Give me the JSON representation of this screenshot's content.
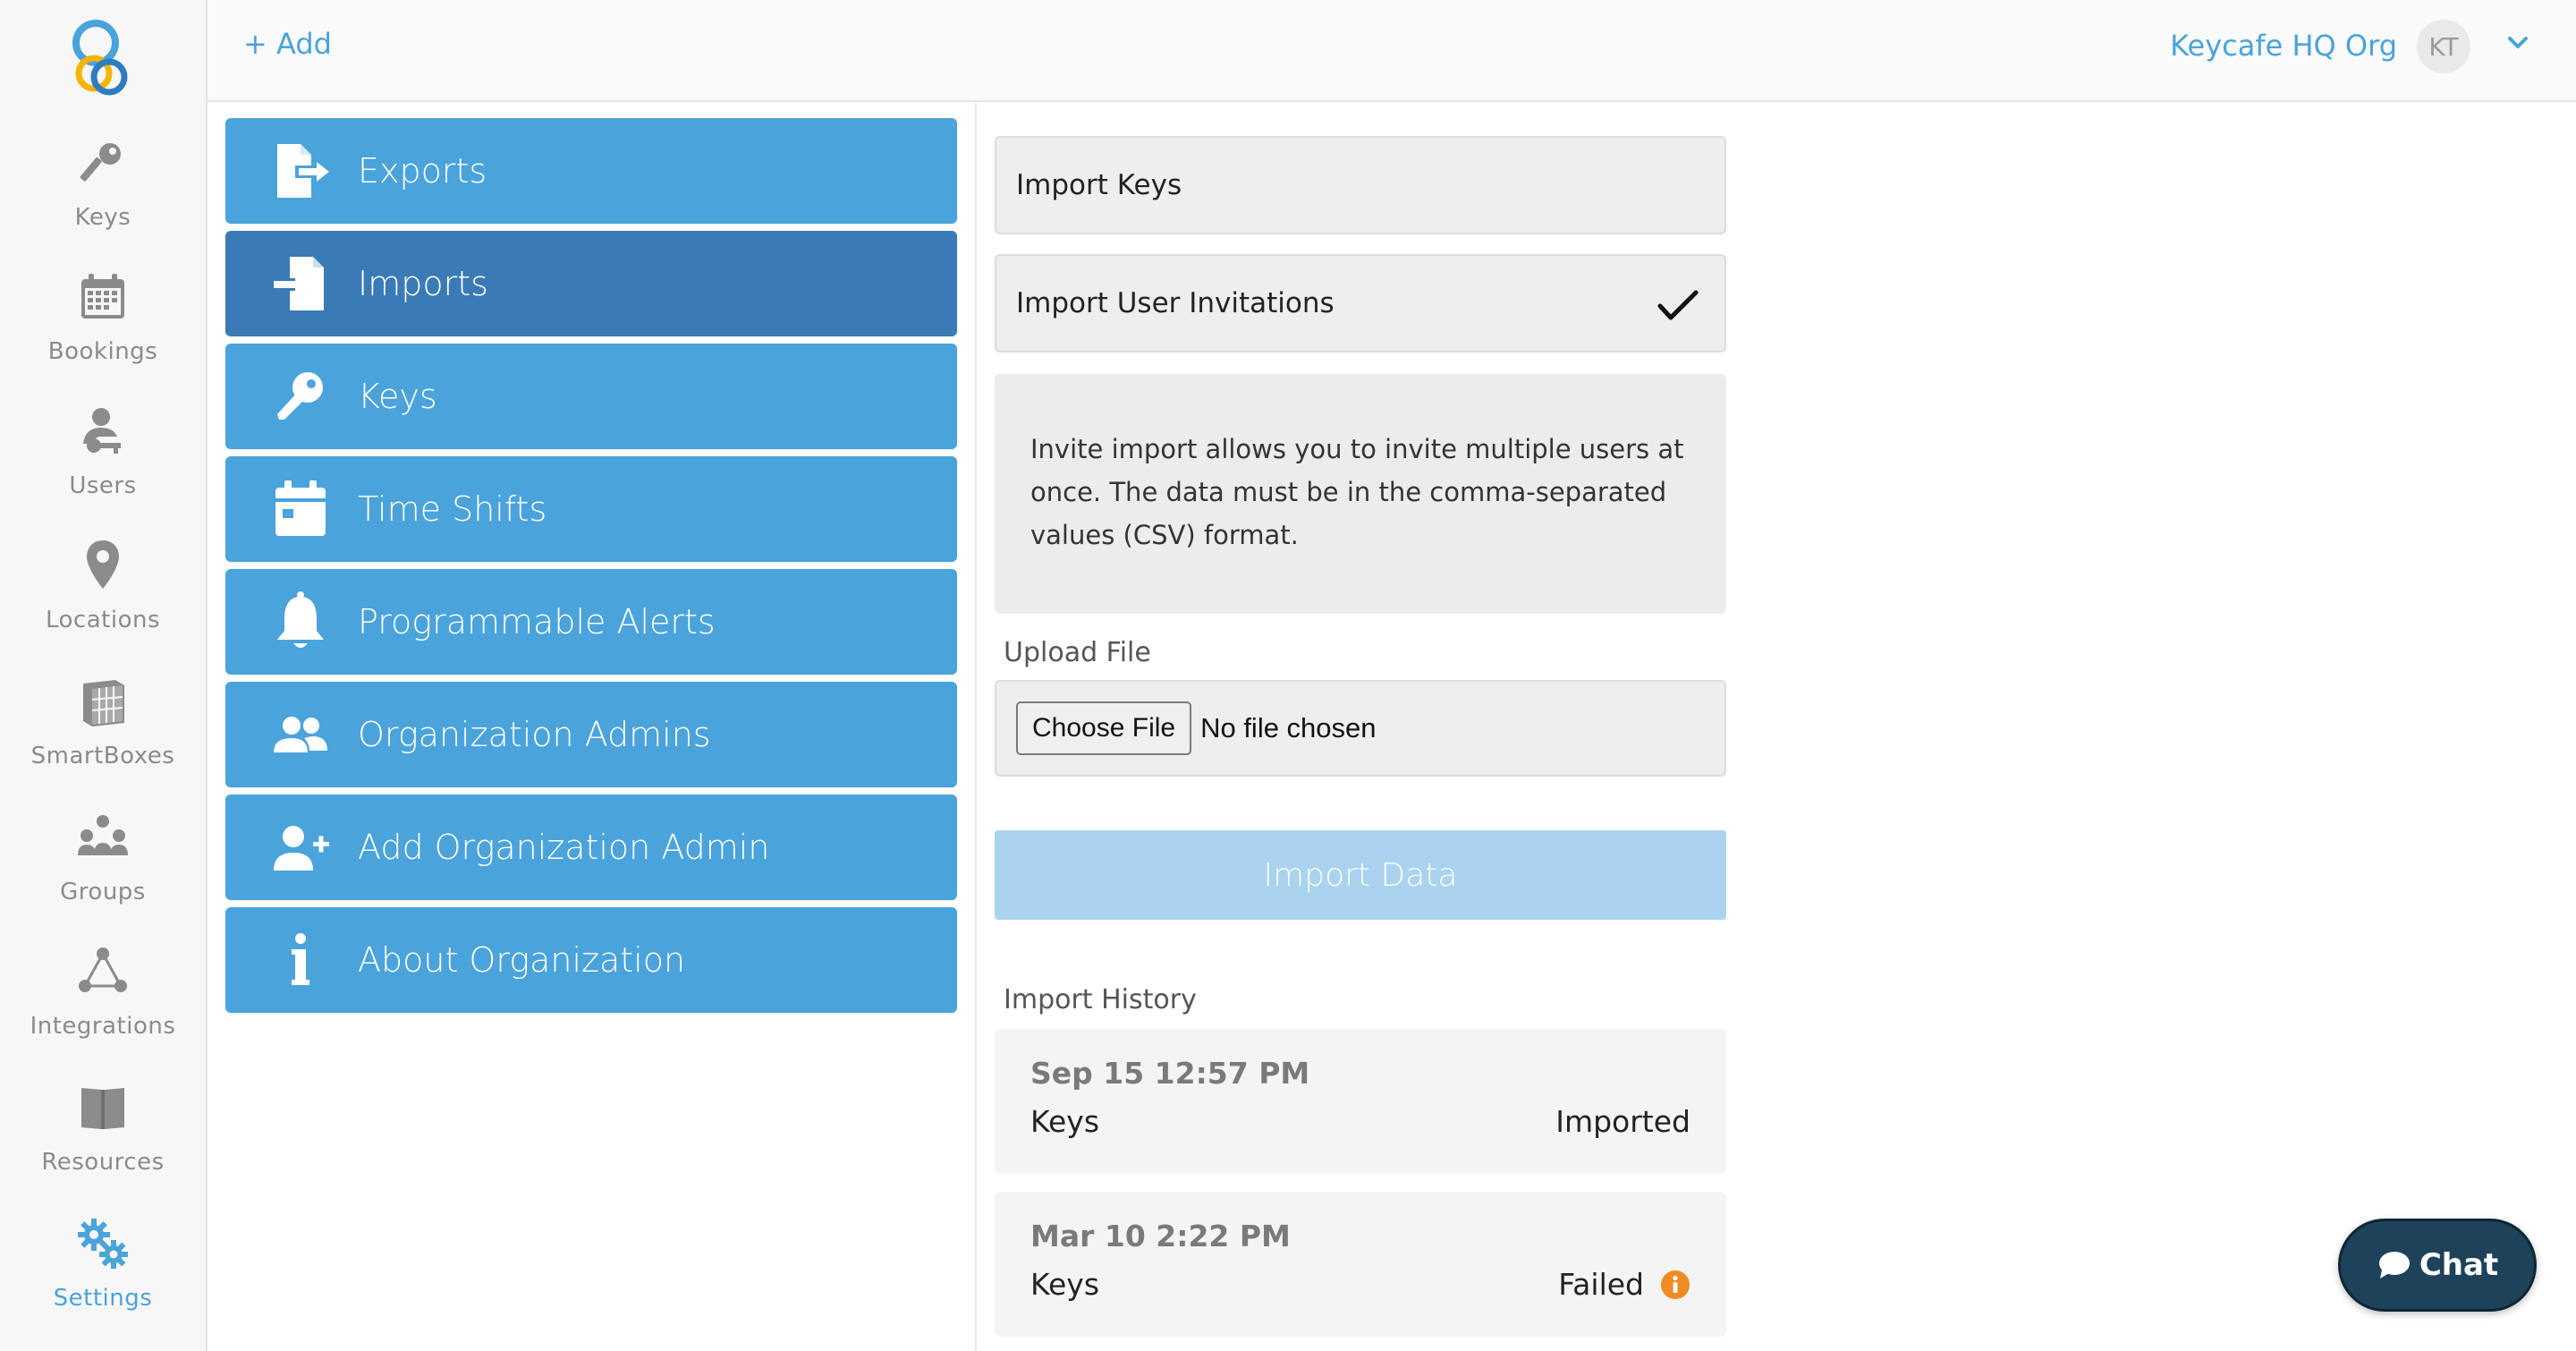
{
  "colors": {
    "accent": "#4aa3db",
    "accent_active": "#3a7ab6",
    "disabled": "#a9d3ee",
    "warning": "#f08a24",
    "chat_bg": "#1e4259"
  },
  "rail": {
    "items": [
      {
        "label": "Keys",
        "icon": "key-icon"
      },
      {
        "label": "Bookings",
        "icon": "calendar-icon"
      },
      {
        "label": "Users",
        "icon": "user-key-icon"
      },
      {
        "label": "Locations",
        "icon": "map-pin-icon"
      },
      {
        "label": "SmartBoxes",
        "icon": "smartbox-icon"
      },
      {
        "label": "Groups",
        "icon": "groups-icon"
      },
      {
        "label": "Integrations",
        "icon": "integrations-icon"
      },
      {
        "label": "Resources",
        "icon": "book-icon"
      },
      {
        "label": "Settings",
        "icon": "gears-icon",
        "active": true
      }
    ]
  },
  "topbar": {
    "add_label": "+ Add",
    "org_name": "Keycafe HQ Org",
    "avatar_initials": "KT"
  },
  "menu": {
    "items": [
      {
        "label": "Exports",
        "icon": "export-file-icon"
      },
      {
        "label": "Imports",
        "icon": "import-file-icon",
        "active": true
      },
      {
        "label": "Keys",
        "icon": "key-icon"
      },
      {
        "label": "Time Shifts",
        "icon": "calendar-icon"
      },
      {
        "label": "Programmable Alerts",
        "icon": "bell-icon"
      },
      {
        "label": "Organization Admins",
        "icon": "users-icon"
      },
      {
        "label": "Add Organization Admin",
        "icon": "user-plus-icon"
      },
      {
        "label": "About Organization",
        "icon": "info-icon"
      }
    ]
  },
  "imports": {
    "options": [
      {
        "label": "Import Keys",
        "selected": false
      },
      {
        "label": "Import User Invitations",
        "selected": true
      }
    ],
    "description": "Invite import allows you to invite multiple users at once. The data must be in the comma-separated values (CSV) format.",
    "upload_label": "Upload File",
    "choose_file_label": "Choose File",
    "no_file_label": "No file chosen",
    "import_button_label": "Import Data",
    "history_label": "Import History",
    "history": [
      {
        "date": "Sep 15 12:57 PM",
        "type": "Keys",
        "status": "Imported"
      },
      {
        "date": "Mar 10 2:22 PM",
        "type": "Keys",
        "status": "Failed"
      }
    ]
  },
  "chat": {
    "label": "Chat"
  }
}
